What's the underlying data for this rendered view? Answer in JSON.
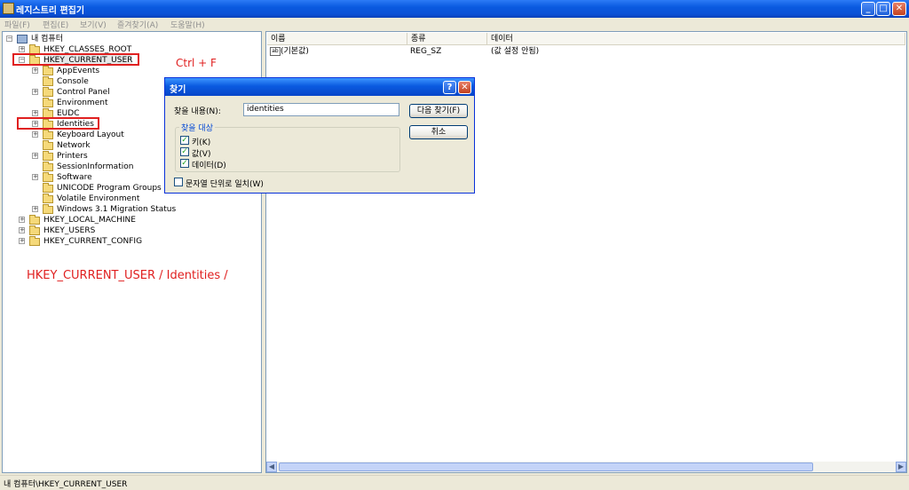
{
  "window": {
    "title": "레지스트리 편집기"
  },
  "menu": [
    "파일(F)",
    "편집(E)",
    "보기(V)",
    "즐겨찾기(A)",
    "도움말(H)"
  ],
  "tree": {
    "root": "내 컴퓨터",
    "hkcr": "HKEY_CLASSES_ROOT",
    "hkcu": "HKEY_CURRENT_USER",
    "children": [
      "AppEvents",
      "Console",
      "Control Panel",
      "Environment",
      "EUDC",
      "Identities",
      "Keyboard Layout",
      "Network",
      "Printers",
      "SessionInformation",
      "Software",
      "UNICODE Program Groups",
      "Volatile Environment",
      "Windows 3.1 Migration Status"
    ],
    "hklm": "HKEY_LOCAL_MACHINE",
    "hku": "HKEY_USERS",
    "hkcc": "HKEY_CURRENT_CONFIG"
  },
  "list": {
    "headers": [
      "이름",
      "종류",
      "데이터"
    ],
    "rows": [
      {
        "icon": "ab",
        "name": "(기본값)",
        "type": "REG_SZ",
        "data": "(값 설정 안됨)"
      }
    ]
  },
  "annotations": {
    "shortcut": "Ctrl + F",
    "path": "HKEY_CURRENT_USER / Identities /",
    "color": "#E02020"
  },
  "status": "내 컴퓨터\\HKEY_CURRENT_USER",
  "dialog": {
    "title": "찾기",
    "help": "?",
    "close": "✕",
    "find_label": "찾을 내용(N):",
    "find_value": "identities",
    "find_next": "다음 찾기(F)",
    "cancel": "취소",
    "group_title": "찾을 대상",
    "chk_keys": "키(K)",
    "chk_values": "값(V)",
    "chk_data": "데이터(D)",
    "chk_whole": "문자열 단위로 일치(W)",
    "checked_mark": "✓"
  }
}
